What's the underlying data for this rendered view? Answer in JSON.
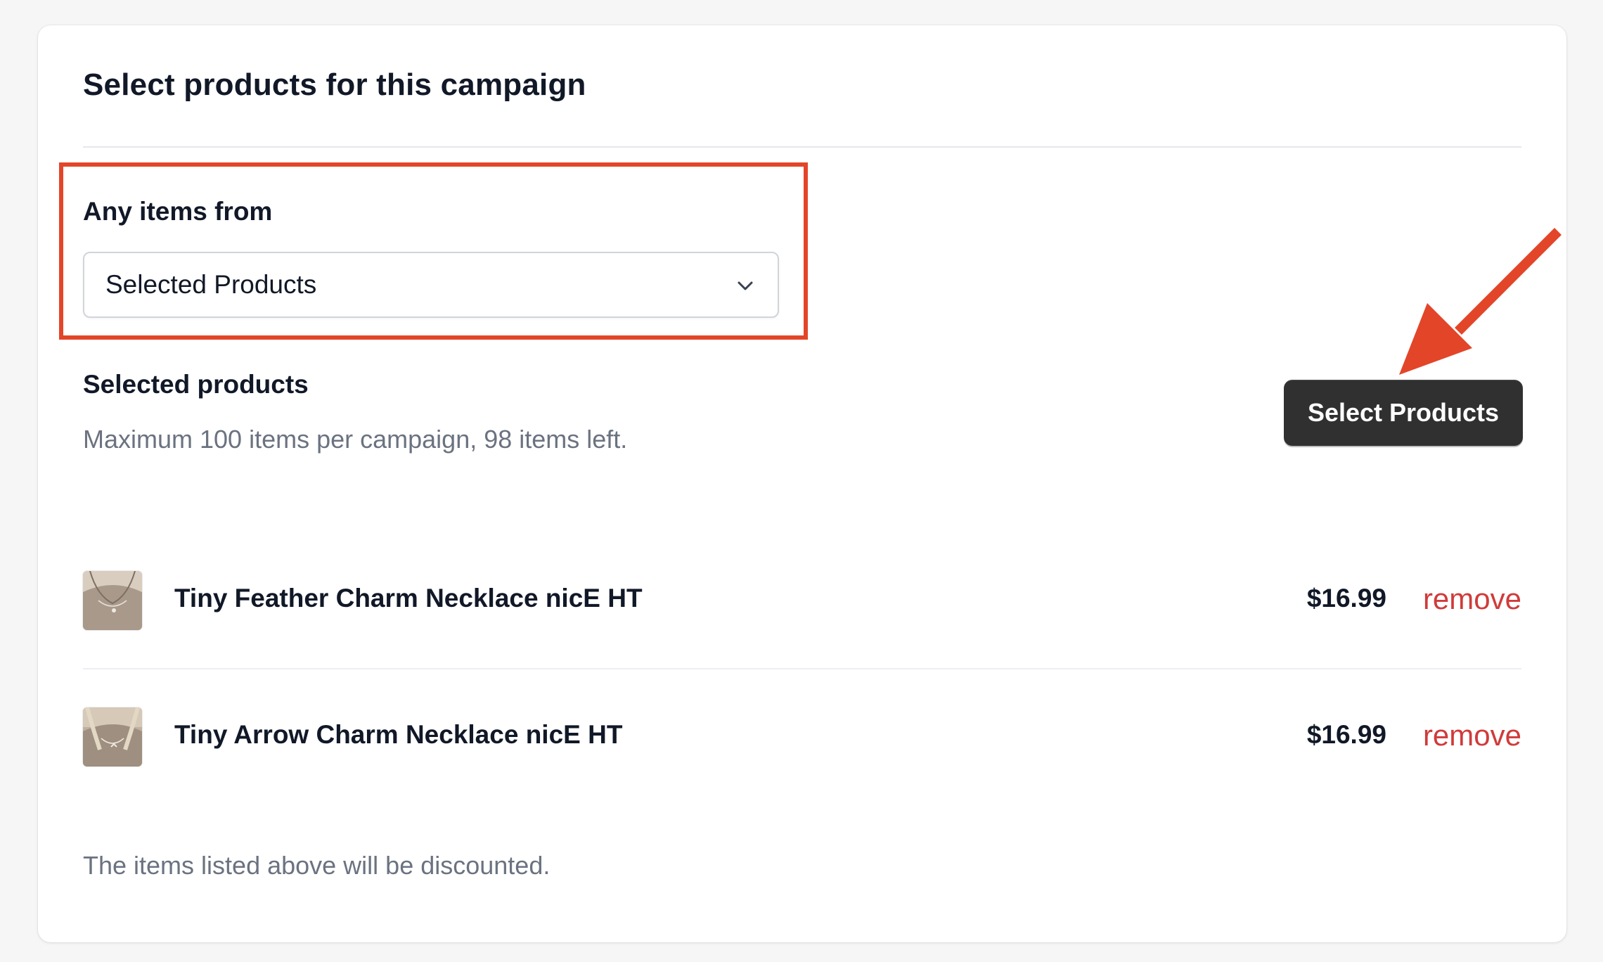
{
  "card": {
    "title": "Select products for this campaign"
  },
  "filter": {
    "label": "Any items from",
    "selected_value": "Selected Products",
    "chevron_icon": "chevron-down-icon"
  },
  "selection": {
    "title": "Selected products",
    "subtitle": "Maximum 100 items per campaign, 98 items left.",
    "select_button_label": "Select Products"
  },
  "products": [
    {
      "name": "Tiny Feather Charm Necklace nicE HT",
      "price": "$16.99",
      "remove_label": "remove",
      "thumbnail_icon": "product-thumbnail"
    },
    {
      "name": "Tiny Arrow Charm Necklace nicE HT",
      "price": "$16.99",
      "remove_label": "remove",
      "thumbnail_icon": "product-thumbnail"
    }
  ],
  "footer": {
    "note": "The items listed above will be discounted."
  },
  "colors": {
    "annotation_red": "#e34529",
    "button_dark": "#303030",
    "remove_red": "#d03b3b",
    "muted_text": "#6b7280"
  }
}
